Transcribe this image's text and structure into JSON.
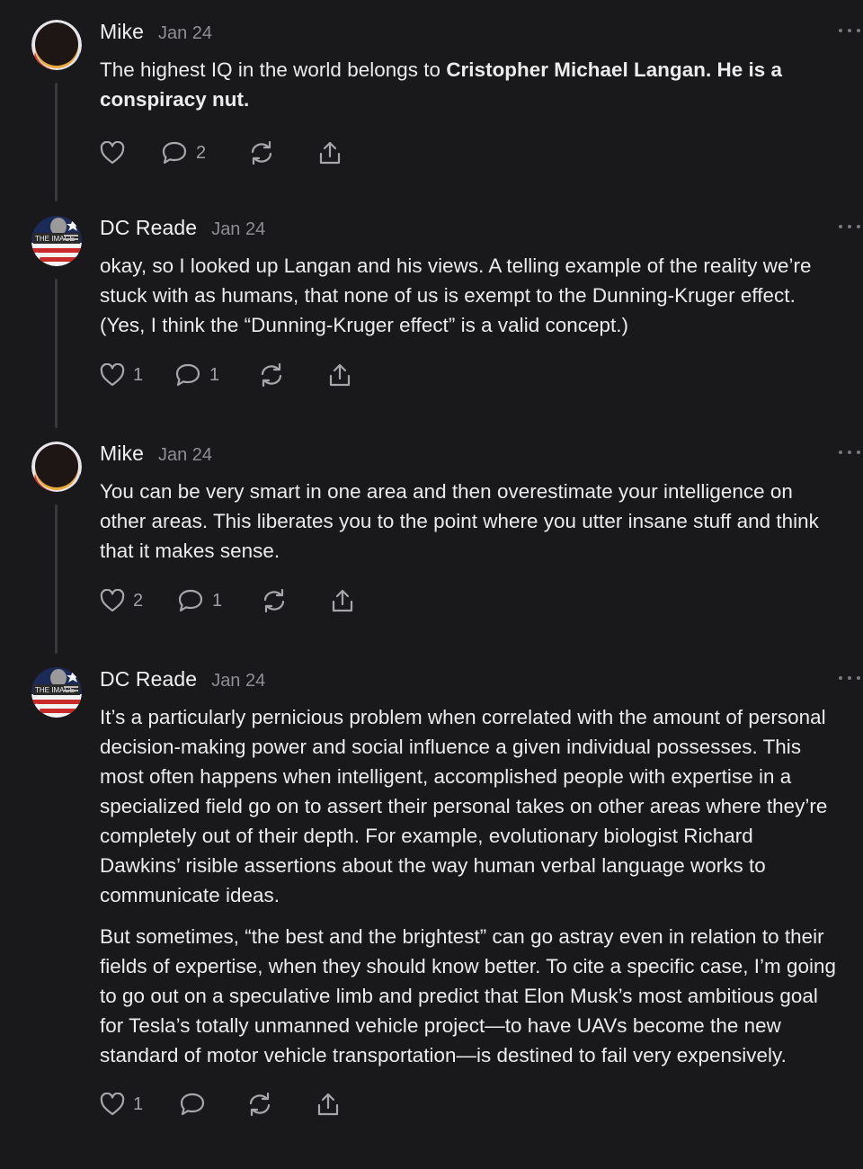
{
  "comments": [
    {
      "author": "Mike",
      "date": "Jan 24",
      "text_plain": "The highest IQ in the world belongs to ",
      "text_bold": "Cristopher Michael Langan. He is a conspiracy nut.",
      "likes": "",
      "replies": "2"
    },
    {
      "author": "DC Reade",
      "date": "Jan 24",
      "text": "okay, so I looked up Langan and his views. A telling example of the reality we’re stuck with as humans, that none of us is exempt to the Dunning-Kruger effect. (Yes, I think the “Dunning-Kruger effect” is a valid concept.)",
      "likes": "1",
      "replies": "1"
    },
    {
      "author": "Mike",
      "date": "Jan 24",
      "text": "You can be very smart in one area and then overestimate your intelligence on other areas. This liberates you to the point where you utter insane stuff and think that it makes sense.",
      "likes": "2",
      "replies": "1"
    },
    {
      "author": "DC Reade",
      "date": "Jan 24",
      "paragraphs": [
        "It’s a particularly pernicious problem when correlated with the amount of personal decision-making power and social influence a given individual possesses. This most often happens when intelligent, accomplished people with expertise in a specialized field go on to assert their personal takes on other areas where they’re completely out of their depth. For example, evolutionary biologist Richard Dawkins’ risible assertions about the way human verbal language works to communicate ideas.",
        "But sometimes, “the best and the brightest” can go astray even in relation to their fields of expertise, when they should know better. To cite a specific case, I’m going to go out on a speculative limb and predict that Elon Musk’s most ambitious goal for Tesla’s totally unmanned vehicle project—to have UAVs become the new standard of motor vehicle transportation—is destined to fail very expensively."
      ],
      "likes": "1",
      "replies": ""
    }
  ],
  "avatar_badges": {
    "dc_reade": "THE IMAGE"
  },
  "colors": {
    "background": "#19191b",
    "text": "#ececec",
    "muted": "#8e8e93",
    "icon": "#a7a7ab",
    "thread_line": "#3a3a3e"
  },
  "icons": [
    "heart-icon",
    "comment-icon",
    "restack-icon",
    "share-icon",
    "more-icon"
  ]
}
